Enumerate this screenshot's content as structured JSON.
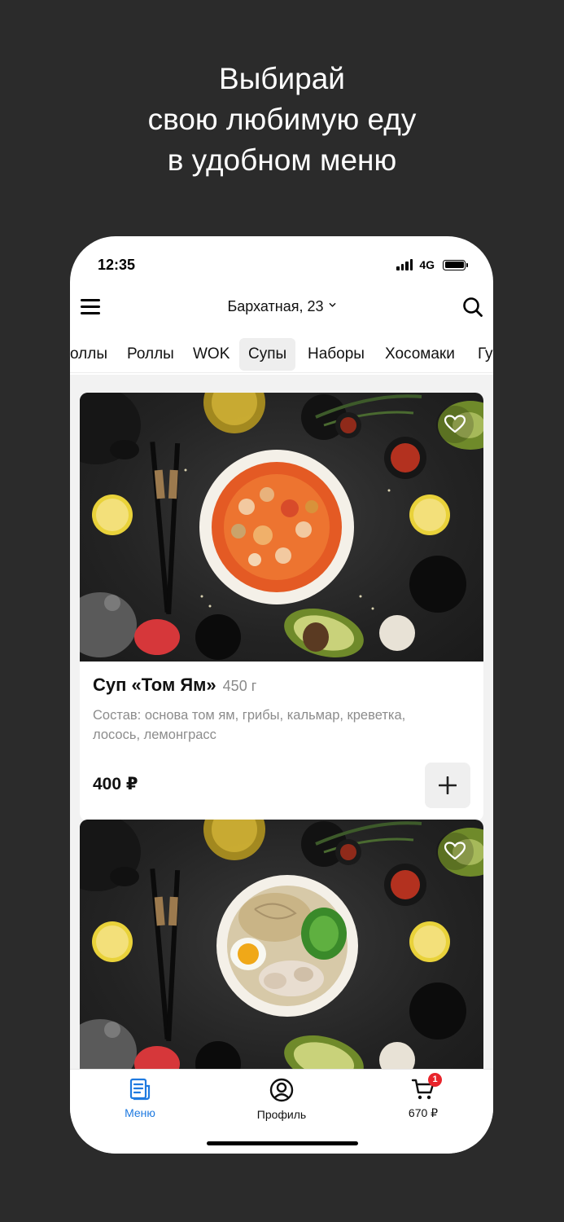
{
  "promo": {
    "line1": "Выбирай",
    "line2": "свою любимую еду",
    "line3": "в удобном меню"
  },
  "status": {
    "time": "12:35",
    "network": "4G"
  },
  "header": {
    "address": "Бархатная, 23"
  },
  "tabs": [
    {
      "label": "оллы"
    },
    {
      "label": "Роллы"
    },
    {
      "label": "WOK"
    },
    {
      "label": "Супы"
    },
    {
      "label": "Наборы"
    },
    {
      "label": "Хосомаки"
    },
    {
      "label": "Гу"
    }
  ],
  "active_tab": "Супы",
  "products": [
    {
      "name": "Суп «Том Ям»",
      "weight": "450 г",
      "description": "Состав: основа том ям, грибы, кальмар, креветка, лосось, лемонграсс",
      "price": "400 ₽"
    }
  ],
  "bottom_nav": {
    "menu": "Меню",
    "profile": "Профиль",
    "cart_total": "670 ₽",
    "cart_badge": "1"
  },
  "colors": {
    "accent": "#1f7ae0",
    "badge": "#e8242b",
    "backdrop": "#2b2b2b"
  },
  "icons": [
    "hamburger-icon",
    "chevron-down-icon",
    "search-icon",
    "heart-icon",
    "plus-icon",
    "menu-doc-icon",
    "profile-icon",
    "cart-icon"
  ]
}
